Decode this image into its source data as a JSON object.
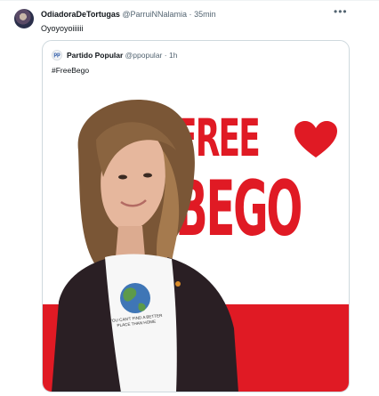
{
  "tweet": {
    "author_name": "OdiadoraDeTortugas",
    "author_handle": "@ParruiNNalamia",
    "time": "35min",
    "text": "Oyoyoyoiiiiii",
    "more_icon": "more-horizontal-icon"
  },
  "quote": {
    "author_name": "Partido Popular",
    "author_handle": "@ppopular",
    "time": "1h",
    "text": "#FreeBego",
    "image": {
      "line1": "FREE",
      "line2": "BEGO",
      "shirt_text": "YOU CAN'T FIND A BETTER PLACE THAN HOME"
    }
  },
  "colors": {
    "accent_red": "#e01a24",
    "text_primary": "#0f1419",
    "text_secondary": "#536471",
    "border": "#cfd9de"
  }
}
